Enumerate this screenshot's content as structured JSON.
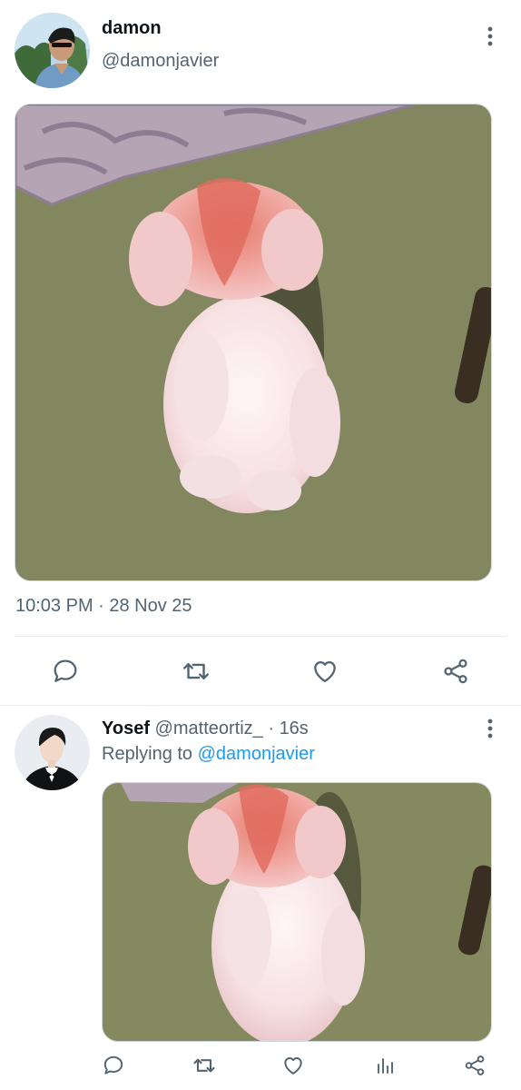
{
  "tweet": {
    "author_name": "damon",
    "author_handle": "@damonjavier",
    "timestamp": "10:03 PM · 28 Nov 25",
    "actions": [
      "reply-icon",
      "retweet-icon",
      "like-icon",
      "share-icon"
    ]
  },
  "reply": {
    "author_name": "Yosef",
    "author_handle": "@matteortiz_",
    "separator": " · ",
    "age": "16s",
    "replying_to_label": "Replying to ",
    "replying_to_handle": "@damonjavier",
    "actions": [
      "reply-icon",
      "retweet-icon",
      "like-icon",
      "analytics-icon",
      "share-icon"
    ]
  },
  "colors": {
    "text": "#0f1419",
    "secondary": "#536471",
    "link": "#1d9bf0",
    "divider": "#e6ecf0"
  }
}
